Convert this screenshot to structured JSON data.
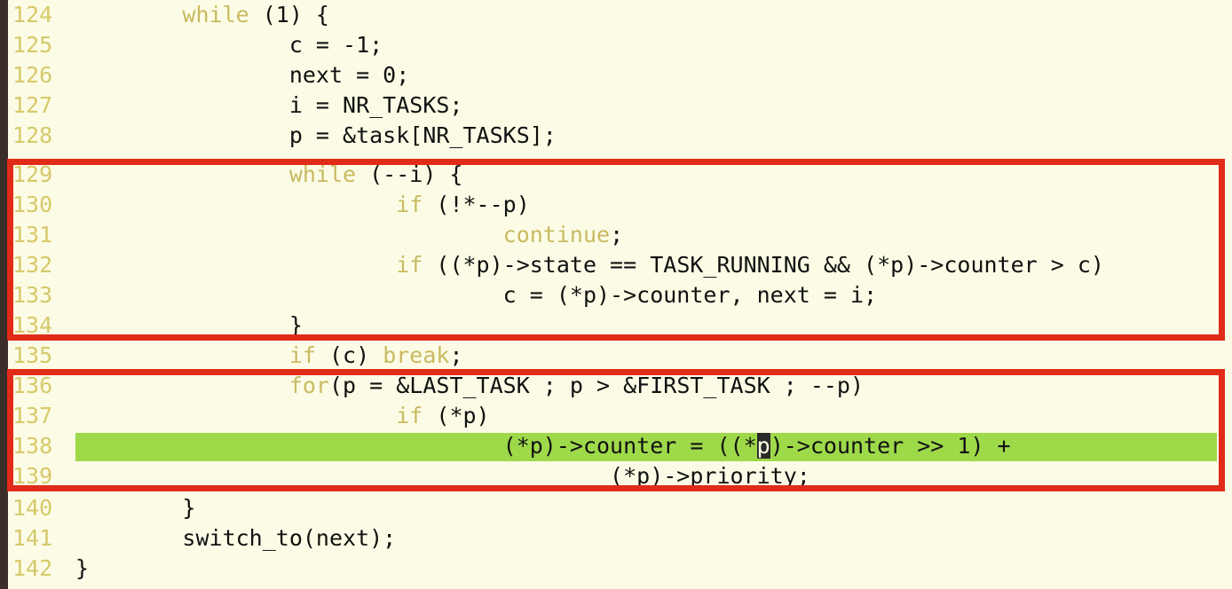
{
  "editor": {
    "language": "c",
    "background_color": "#fcfce6",
    "line_number_color": "#d6c96a",
    "keyword_color": "#c9ba61",
    "text_color": "#111111",
    "highlight_color": "#9ed94a",
    "annotation_color": "#e02b18",
    "cursor_color": "#2a2a2a",
    "first_line": 124,
    "last_line": 142,
    "highlighted_line": 138,
    "cursor": {
      "line": 138,
      "char": "p"
    },
    "lines": [
      {
        "number": "124",
        "text": "        while (1) {",
        "keyword": "while",
        "highlighted": false
      },
      {
        "number": "125",
        "text": "                c = -1;",
        "keyword": "",
        "highlighted": false
      },
      {
        "number": "126",
        "text": "                next = 0;",
        "keyword": "",
        "highlighted": false
      },
      {
        "number": "127",
        "text": "                i = NR_TASKS;",
        "keyword": "",
        "highlighted": false
      },
      {
        "number": "128",
        "text": "                p = &task[NR_TASKS];",
        "keyword": "",
        "highlighted": false
      },
      {
        "number": "129",
        "text": "                while (--i) {",
        "keyword": "while",
        "highlighted": false
      },
      {
        "number": "130",
        "text": "                        if (!*--p)",
        "keyword": "if",
        "highlighted": false
      },
      {
        "number": "131",
        "text": "                                continue;",
        "keyword": "continue",
        "highlighted": false
      },
      {
        "number": "132",
        "text": "                        if ((*p)->state == TASK_RUNNING && (*p)->counter > c)",
        "keyword": "if",
        "highlighted": false
      },
      {
        "number": "133",
        "text": "                                c = (*p)->counter, next = i;",
        "keyword": "",
        "highlighted": false
      },
      {
        "number": "134",
        "text": "                }",
        "keyword": "",
        "highlighted": false
      },
      {
        "number": "135",
        "text": "                if (c) break;",
        "keyword": "if break",
        "highlighted": false
      },
      {
        "number": "136",
        "text": "                for(p = &LAST_TASK ; p > &FIRST_TASK ; --p)",
        "keyword": "for",
        "highlighted": false
      },
      {
        "number": "137",
        "text": "                        if (*p)",
        "keyword": "if",
        "highlighted": false
      },
      {
        "number": "138",
        "text": "                                (*p)->counter = ((*p)->counter >> 1) +",
        "keyword": "",
        "highlighted": true
      },
      {
        "number": "139",
        "text": "                                        (*p)->priority;",
        "keyword": "",
        "highlighted": false
      },
      {
        "number": "140",
        "text": "        }",
        "keyword": "",
        "highlighted": false
      },
      {
        "number": "141",
        "text": "        switch_to(next);",
        "keyword": "",
        "highlighted": false
      },
      {
        "number": "142",
        "text": "}",
        "keyword": "",
        "highlighted": false
      }
    ]
  },
  "annotations": [
    {
      "label": "task-selection-loop-box",
      "start_line": "129",
      "end_line": "134"
    },
    {
      "label": "counter-recalculation-box",
      "start_line": "136",
      "end_line": "139"
    }
  ]
}
